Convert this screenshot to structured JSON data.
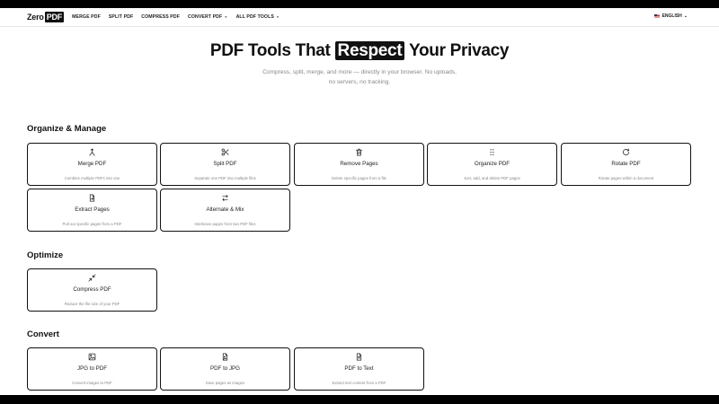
{
  "header": {
    "logo_zero": "Zero",
    "logo_pdf": "PDF",
    "nav": [
      {
        "label": "MERGE PDF"
      },
      {
        "label": "SPLIT PDF"
      },
      {
        "label": "COMPRESS PDF"
      },
      {
        "label": "CONVERT PDF",
        "dropdown": true
      },
      {
        "label": "ALL PDF TOOLS",
        "dropdown": true
      }
    ],
    "language": "ENGLISH"
  },
  "hero": {
    "title_before": "PDF Tools That ",
    "title_highlight": "Respect",
    "title_after": " Your Privacy",
    "subtitle_line1": "Compress, split, merge, and more — directly in your browser. No uploads,",
    "subtitle_line2": "no servers, no tracking."
  },
  "sections": {
    "organize": {
      "title": "Organize & Manage",
      "cards": [
        {
          "title": "Merge PDF",
          "desc": "Combine multiple PDFs into one",
          "icon": "merge-icon"
        },
        {
          "title": "Split PDF",
          "desc": "Separate one PDF into multiple files",
          "icon": "scissors-icon"
        },
        {
          "title": "Remove Pages",
          "desc": "Delete specific pages from a file",
          "icon": "trash-icon"
        },
        {
          "title": "Organize PDF",
          "desc": "Sort, add, and delete PDF pages",
          "icon": "grip-icon"
        },
        {
          "title": "Rotate PDF",
          "desc": "Rotate pages within a document",
          "icon": "rotate-icon"
        },
        {
          "title": "Extract Pages",
          "desc": "Pull out specific pages from a PDF",
          "icon": "file-export-icon"
        },
        {
          "title": "Alternate & Mix",
          "desc": "Interleave pages from two PDF files",
          "icon": "swap-arrows-icon"
        }
      ]
    },
    "optimize": {
      "title": "Optimize",
      "cards": [
        {
          "title": "Compress PDF",
          "desc": "Reduce the file size of your PDF",
          "icon": "compress-arrows-icon"
        }
      ]
    },
    "convert": {
      "title": "Convert",
      "cards": [
        {
          "title": "JPG to PDF",
          "desc": "Convert images to PDF",
          "icon": "image-icon"
        },
        {
          "title": "PDF to JPG",
          "desc": "Save pages as images",
          "icon": "file-image-icon"
        },
        {
          "title": "PDF to Text",
          "desc": "Extract text content from a PDF",
          "icon": "file-text-icon"
        }
      ]
    }
  }
}
